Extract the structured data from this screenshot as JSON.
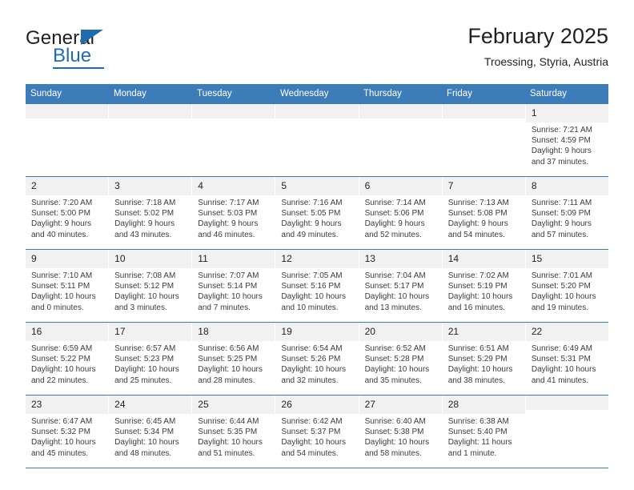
{
  "brand": {
    "name_part1": "General",
    "name_part2": "Blue",
    "triangle_icon": "triangle-icon",
    "accent_color": "#1f6cb0"
  },
  "header": {
    "title": "February 2025",
    "subtitle": "Troessing, Styria, Austria"
  },
  "theme": {
    "header_blue": "#3c7cb9",
    "daynum_band": "#f1f1f1",
    "text": "#231f20",
    "detail_text": "#3b3b3b"
  },
  "calendar": {
    "weekday_headers": [
      "Sunday",
      "Monday",
      "Tuesday",
      "Wednesday",
      "Thursday",
      "Friday",
      "Saturday"
    ],
    "weeks": [
      [
        {
          "day": "",
          "lines": []
        },
        {
          "day": "",
          "lines": []
        },
        {
          "day": "",
          "lines": []
        },
        {
          "day": "",
          "lines": []
        },
        {
          "day": "",
          "lines": []
        },
        {
          "day": "",
          "lines": []
        },
        {
          "day": "1",
          "lines": [
            "Sunrise: 7:21 AM",
            "Sunset: 4:59 PM",
            "Daylight: 9 hours",
            "and 37 minutes."
          ]
        }
      ],
      [
        {
          "day": "2",
          "lines": [
            "Sunrise: 7:20 AM",
            "Sunset: 5:00 PM",
            "Daylight: 9 hours",
            "and 40 minutes."
          ]
        },
        {
          "day": "3",
          "lines": [
            "Sunrise: 7:18 AM",
            "Sunset: 5:02 PM",
            "Daylight: 9 hours",
            "and 43 minutes."
          ]
        },
        {
          "day": "4",
          "lines": [
            "Sunrise: 7:17 AM",
            "Sunset: 5:03 PM",
            "Daylight: 9 hours",
            "and 46 minutes."
          ]
        },
        {
          "day": "5",
          "lines": [
            "Sunrise: 7:16 AM",
            "Sunset: 5:05 PM",
            "Daylight: 9 hours",
            "and 49 minutes."
          ]
        },
        {
          "day": "6",
          "lines": [
            "Sunrise: 7:14 AM",
            "Sunset: 5:06 PM",
            "Daylight: 9 hours",
            "and 52 minutes."
          ]
        },
        {
          "day": "7",
          "lines": [
            "Sunrise: 7:13 AM",
            "Sunset: 5:08 PM",
            "Daylight: 9 hours",
            "and 54 minutes."
          ]
        },
        {
          "day": "8",
          "lines": [
            "Sunrise: 7:11 AM",
            "Sunset: 5:09 PM",
            "Daylight: 9 hours",
            "and 57 minutes."
          ]
        }
      ],
      [
        {
          "day": "9",
          "lines": [
            "Sunrise: 7:10 AM",
            "Sunset: 5:11 PM",
            "Daylight: 10 hours",
            "and 0 minutes."
          ]
        },
        {
          "day": "10",
          "lines": [
            "Sunrise: 7:08 AM",
            "Sunset: 5:12 PM",
            "Daylight: 10 hours",
            "and 3 minutes."
          ]
        },
        {
          "day": "11",
          "lines": [
            "Sunrise: 7:07 AM",
            "Sunset: 5:14 PM",
            "Daylight: 10 hours",
            "and 7 minutes."
          ]
        },
        {
          "day": "12",
          "lines": [
            "Sunrise: 7:05 AM",
            "Sunset: 5:16 PM",
            "Daylight: 10 hours",
            "and 10 minutes."
          ]
        },
        {
          "day": "13",
          "lines": [
            "Sunrise: 7:04 AM",
            "Sunset: 5:17 PM",
            "Daylight: 10 hours",
            "and 13 minutes."
          ]
        },
        {
          "day": "14",
          "lines": [
            "Sunrise: 7:02 AM",
            "Sunset: 5:19 PM",
            "Daylight: 10 hours",
            "and 16 minutes."
          ]
        },
        {
          "day": "15",
          "lines": [
            "Sunrise: 7:01 AM",
            "Sunset: 5:20 PM",
            "Daylight: 10 hours",
            "and 19 minutes."
          ]
        }
      ],
      [
        {
          "day": "16",
          "lines": [
            "Sunrise: 6:59 AM",
            "Sunset: 5:22 PM",
            "Daylight: 10 hours",
            "and 22 minutes."
          ]
        },
        {
          "day": "17",
          "lines": [
            "Sunrise: 6:57 AM",
            "Sunset: 5:23 PM",
            "Daylight: 10 hours",
            "and 25 minutes."
          ]
        },
        {
          "day": "18",
          "lines": [
            "Sunrise: 6:56 AM",
            "Sunset: 5:25 PM",
            "Daylight: 10 hours",
            "and 28 minutes."
          ]
        },
        {
          "day": "19",
          "lines": [
            "Sunrise: 6:54 AM",
            "Sunset: 5:26 PM",
            "Daylight: 10 hours",
            "and 32 minutes."
          ]
        },
        {
          "day": "20",
          "lines": [
            "Sunrise: 6:52 AM",
            "Sunset: 5:28 PM",
            "Daylight: 10 hours",
            "and 35 minutes."
          ]
        },
        {
          "day": "21",
          "lines": [
            "Sunrise: 6:51 AM",
            "Sunset: 5:29 PM",
            "Daylight: 10 hours",
            "and 38 minutes."
          ]
        },
        {
          "day": "22",
          "lines": [
            "Sunrise: 6:49 AM",
            "Sunset: 5:31 PM",
            "Daylight: 10 hours",
            "and 41 minutes."
          ]
        }
      ],
      [
        {
          "day": "23",
          "lines": [
            "Sunrise: 6:47 AM",
            "Sunset: 5:32 PM",
            "Daylight: 10 hours",
            "and 45 minutes."
          ]
        },
        {
          "day": "24",
          "lines": [
            "Sunrise: 6:45 AM",
            "Sunset: 5:34 PM",
            "Daylight: 10 hours",
            "and 48 minutes."
          ]
        },
        {
          "day": "25",
          "lines": [
            "Sunrise: 6:44 AM",
            "Sunset: 5:35 PM",
            "Daylight: 10 hours",
            "and 51 minutes."
          ]
        },
        {
          "day": "26",
          "lines": [
            "Sunrise: 6:42 AM",
            "Sunset: 5:37 PM",
            "Daylight: 10 hours",
            "and 54 minutes."
          ]
        },
        {
          "day": "27",
          "lines": [
            "Sunrise: 6:40 AM",
            "Sunset: 5:38 PM",
            "Daylight: 10 hours",
            "and 58 minutes."
          ]
        },
        {
          "day": "28",
          "lines": [
            "Sunrise: 6:38 AM",
            "Sunset: 5:40 PM",
            "Daylight: 11 hours",
            "and 1 minute."
          ]
        },
        {
          "day": "",
          "lines": []
        }
      ]
    ]
  }
}
